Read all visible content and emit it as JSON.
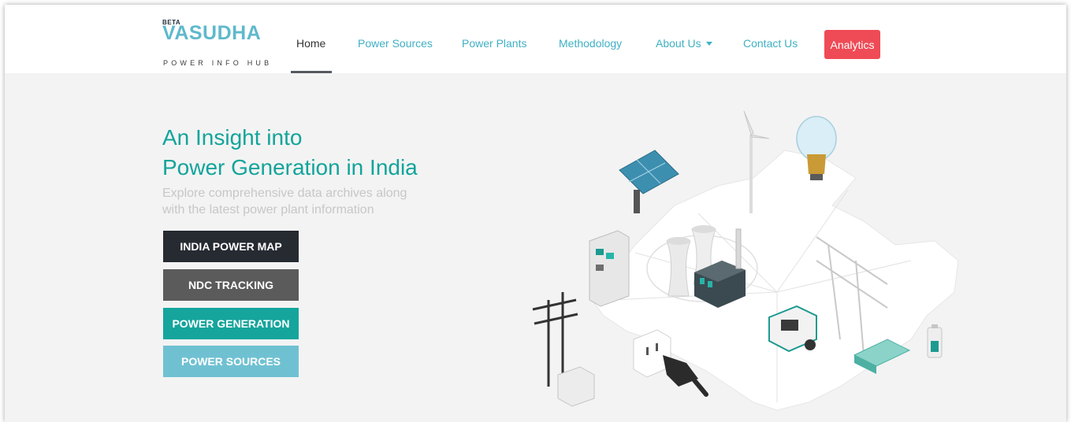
{
  "brand": {
    "beta": "BETA",
    "name": "VASUDHA",
    "tagline": "POWER INFO HUB"
  },
  "nav": {
    "items": [
      {
        "label": "Home",
        "active": true
      },
      {
        "label": "Power Sources"
      },
      {
        "label": "Power Plants"
      },
      {
        "label": "Methodology"
      },
      {
        "label": "About Us",
        "dropdown": true
      },
      {
        "label": "Contact Us"
      }
    ],
    "analytics_label": "Analytics"
  },
  "hero": {
    "title_line1": "An Insight into",
    "title_line2": "Power Generation in India",
    "subtitle_line1": "Explore comprehensive data archives along",
    "subtitle_line2": "with the latest power plant information"
  },
  "buttons": [
    {
      "label": "INDIA POWER MAP",
      "color": "#262a31"
    },
    {
      "label": "NDC TRACKING",
      "color": "#5b5b5b"
    },
    {
      "label": "POWER GENERATION",
      "color": "#15a59c"
    },
    {
      "label": "POWER SOURCES",
      "color": "#6fc1d2"
    }
  ],
  "colors": {
    "accent_teal": "#12a49b",
    "brand_blue": "#5fb9cc",
    "analytics_red": "#ef4b56",
    "background": "#f3f3f3"
  }
}
